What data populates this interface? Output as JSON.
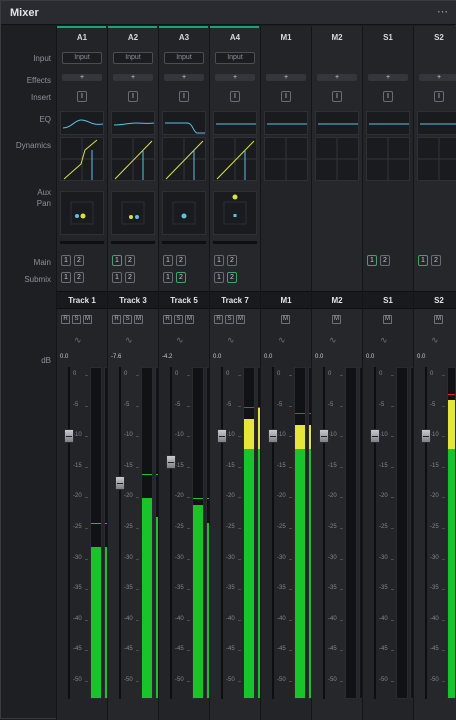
{
  "panel": {
    "title": "Mixer",
    "menu_icon": "ellipsis-icon"
  },
  "row_labels": {
    "input": "Input",
    "effects": "Effects",
    "insert": "Insert",
    "eq": "EQ",
    "dynamics": "Dynamics",
    "aux_pan": "Aux\nPan",
    "main": "Main",
    "submix": "Submix",
    "db": "dB"
  },
  "scale_marks": [
    "0",
    "-5",
    "-10",
    "-15",
    "-20",
    "-25",
    "-30",
    "-35",
    "-40",
    "-45",
    "-50"
  ],
  "channels": [
    {
      "bus": "A1",
      "track": "Track 1",
      "type": "audio",
      "input": "Input",
      "db": "0.0",
      "fader_db": -10,
      "meter_db": -28,
      "meter_db2": -28,
      "peak_db": -24,
      "main": [
        "1",
        "2"
      ],
      "submix": [
        "1",
        "2"
      ],
      "main_active": [],
      "submix_active": []
    },
    {
      "bus": "A2",
      "track": "Track 3",
      "type": "audio",
      "input": "Input",
      "db": "-7.6",
      "fader_db": -17.6,
      "meter_db": -20,
      "meter_db2": -23,
      "peak_db": -16,
      "main": [
        "1",
        "2"
      ],
      "submix": [
        "1",
        "2"
      ],
      "main_active": [
        "1"
      ],
      "submix_active": []
    },
    {
      "bus": "A3",
      "track": "Track 5",
      "type": "audio",
      "input": "Input",
      "db": "-4.2",
      "fader_db": -14.2,
      "meter_db": -21,
      "meter_db2": -24,
      "peak_db": -20,
      "main": [
        "1",
        "2"
      ],
      "submix": [
        "1",
        "2"
      ],
      "main_active": [],
      "submix_active": [
        "2"
      ]
    },
    {
      "bus": "A4",
      "track": "Track 7",
      "type": "audio",
      "input": "Input",
      "db": "0.0",
      "fader_db": -10,
      "meter_db": -7,
      "meter_db2": -5,
      "peak_db": -5,
      "main": [
        "1",
        "2"
      ],
      "submix": [
        "1",
        "2"
      ],
      "main_active": [],
      "submix_active": [
        "2"
      ]
    },
    {
      "bus": "M1",
      "track": "M1",
      "type": "main",
      "input": "",
      "db": "0.0",
      "fader_db": -10,
      "meter_db": -8,
      "meter_db2": -8,
      "peak_db": -6,
      "main": [],
      "submix": [],
      "main_active": [],
      "submix_active": []
    },
    {
      "bus": "M2",
      "track": "M2",
      "type": "main",
      "input": "",
      "db": "0.0",
      "fader_db": -10,
      "meter_db": -60,
      "meter_db2": -60,
      "peak_db": null,
      "main": [],
      "submix": [],
      "main_active": [],
      "submix_active": []
    },
    {
      "bus": "S1",
      "track": "S1",
      "type": "sub",
      "input": "",
      "db": "0.0",
      "fader_db": -10,
      "meter_db": -60,
      "meter_db2": -60,
      "peak_db": null,
      "main": [
        "1",
        "2"
      ],
      "submix": [],
      "main_active": [
        "1"
      ],
      "submix_active": []
    },
    {
      "bus": "S2",
      "track": "S2",
      "type": "sub",
      "input": "",
      "db": "0.0",
      "fader_db": -10,
      "meter_db": -4,
      "meter_db2": -4,
      "peak_db": -3,
      "main": [
        "1",
        "2"
      ],
      "submix": [],
      "main_active": [
        "1"
      ],
      "submix_active": []
    }
  ],
  "rsm_labels": [
    "R",
    "S",
    "M"
  ],
  "mute_label": "M",
  "insert_label": "I",
  "effects_label": "+",
  "colors": {
    "accent": "#1aa37a",
    "meter_green": "#19c42a",
    "meter_yellow": "#e5e53a",
    "meter_red": "#e52323",
    "curve": "#5bc2e6",
    "dyn_line": "#d8e23a"
  }
}
